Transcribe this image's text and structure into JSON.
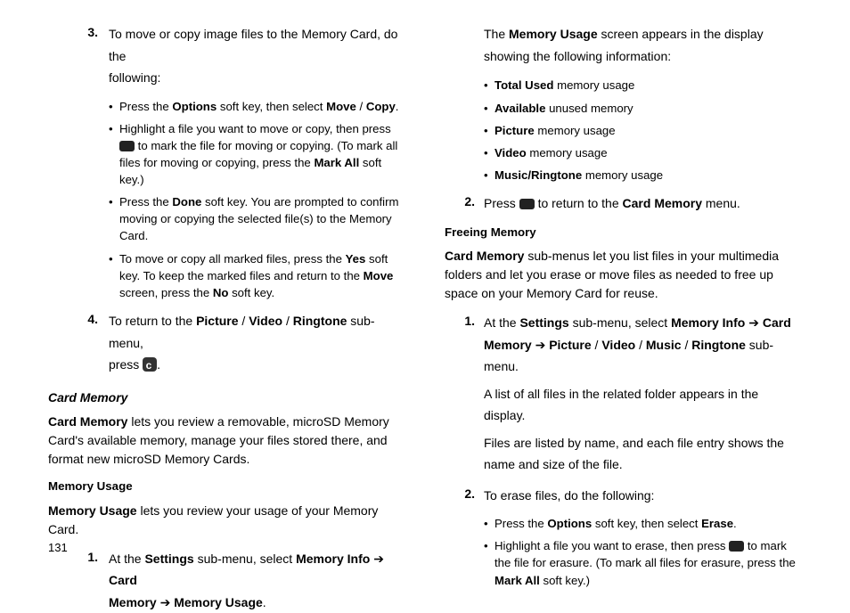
{
  "page_number": "131",
  "left": {
    "step3_num": "3.",
    "step3_text_a": "To move or copy image files to the Memory Card, do the",
    "step3_text_b": "following:",
    "s3_b1a": "Press the ",
    "s3_b1b": "Options",
    "s3_b1c": " soft key, then select ",
    "s3_b1d": "Move",
    "s3_b1e": " / ",
    "s3_b1f": "Copy",
    "s3_b1g": ".",
    "s3_b2a": "Highlight a file you want to move or copy, then press ",
    "s3_b2b": " to mark the file for moving or copying. (To mark all files for moving or copying, press the ",
    "s3_b2c": "Mark All",
    "s3_b2d": " soft key.)",
    "s3_b3a": "Press the ",
    "s3_b3b": "Done",
    "s3_b3c": " soft key. You are prompted to confirm moving or copying the selected file(s) to the Memory Card.",
    "s3_b4a": "To move or copy all marked files, press the ",
    "s3_b4b": "Yes",
    "s3_b4c": " soft key. To keep the marked files and return to the ",
    "s3_b4d": "Move",
    "s3_b4e": " screen, press the ",
    "s3_b4f": "No",
    "s3_b4g": " soft key.",
    "step4_num": "4.",
    "step4_a": "To return to the ",
    "step4_b": "Picture",
    "step4_c": " / ",
    "step4_d": "Video",
    "step4_e": " / ",
    "step4_f": "Ringtone",
    "step4_g": " sub-menu,",
    "step4_h": "press  ",
    "step4_i": ".",
    "card_memory_h": "Card Memory",
    "card_memory_p_a": "Card Memory",
    "card_memory_p_b": " lets you review a removable, microSD Memory Card's available memory, manage your files stored there, and format new microSD Memory Cards.",
    "mem_usage_h": "Memory Usage",
    "mem_usage_p_a": "Memory Usage",
    "mem_usage_p_b": " lets you review your usage of your Memory Card.",
    "mu1_num": "1.",
    "mu1_a": "At the ",
    "mu1_b": "Settings",
    "mu1_c": " sub-menu, select ",
    "mu1_d": "Memory Info",
    "mu1_e": " ➔ ",
    "mu1_f": "Card",
    "mu1_g": "Memory",
    "mu1_h": " ➔ ",
    "mu1_i": "Memory Usage",
    "mu1_j": "."
  },
  "right": {
    "intro_a": "The ",
    "intro_b": "Memory Usage",
    "intro_c": " screen appears in the display",
    "intro_d": "showing the following information:",
    "b1a": "Total Used",
    "b1b": " memory usage",
    "b2a": "Available",
    "b2b": " unused memory",
    "b3a": "Picture",
    "b3b": " memory usage",
    "b4a": "Video",
    "b4b": " memory usage",
    "b5a": "Music/Ringtone",
    "b5b": " memory usage",
    "r2_num": "2.",
    "r2_a": "Press  ",
    "r2_b": "  to return to the ",
    "r2_c": "Card Memory",
    "r2_d": " menu.",
    "free_h": "Freeing Memory",
    "free_p_a": "Card Memory",
    "free_p_b": " sub-menus let you list files in your multimedia folders and let you erase or move files as needed to free up space on your Memory Card for reuse.",
    "f1_num": "1.",
    "f1_a": "At the ",
    "f1_b": "Settings",
    "f1_c": " sub-menu, select ",
    "f1_d": "Memory Info",
    "f1_e": " ➔ ",
    "f1_f": "Card",
    "f1_g": "Memory",
    "f1_h": " ➔ ",
    "f1_i": "Picture",
    "f1_j": " / ",
    "f1_k": "Video",
    "f1_l": " / ",
    "f1_m": "Music",
    "f1_n": " / ",
    "f1_o": "Ringtone",
    "f1_p": " sub-menu.",
    "f1_q": "A list of all files in the related folder appears in the display.",
    "f1_r": "Files are listed by name, and each file entry shows the",
    "f1_s": "name and size of the file.",
    "f2_num": "2.",
    "f2_a": "To erase files, do the following:",
    "f2b1a": "Press the ",
    "f2b1b": "Options",
    "f2b1c": " soft key, then select ",
    "f2b1d": "Erase",
    "f2b1e": ".",
    "f2b2a": "Highlight a file you want to erase, then press ",
    "f2b2b": " to mark the file for erasure. (To mark all files for erasure, press the ",
    "f2b2c": "Mark All",
    "f2b2d": " soft key.)"
  }
}
